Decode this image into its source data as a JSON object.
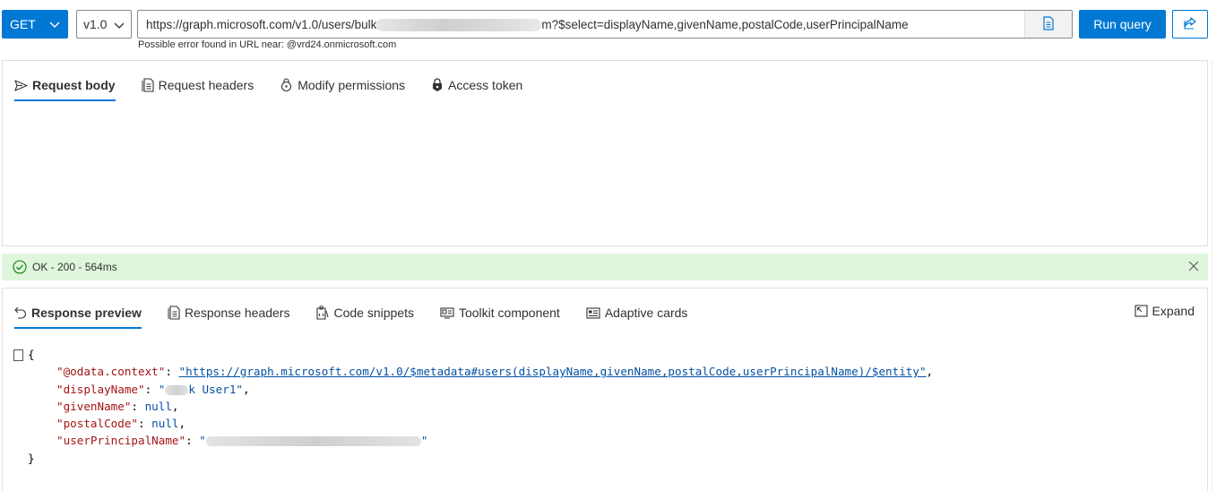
{
  "query": {
    "method": "GET",
    "version": "v1.0",
    "url_prefix": "https://graph.microsoft.com/v1.0/users/bulk",
    "url_suffix": "m?$select=displayName,givenName,postalCode,userPrincipalName",
    "error_hint": "Possible error found in URL near: @vrd24.onmicrosoft.com",
    "run_label": "Run query"
  },
  "request_tabs": [
    {
      "label": "Request body",
      "icon": "send-icon"
    },
    {
      "label": "Request headers",
      "icon": "document-icon"
    },
    {
      "label": "Modify permissions",
      "icon": "permissions-lock-icon"
    },
    {
      "label": "Access token",
      "icon": "shield-lock-icon"
    }
  ],
  "status": {
    "text": "OK - 200 - 564ms",
    "color": "#dff6dd"
  },
  "response_tabs": [
    {
      "label": "Response preview",
      "icon": "undo-arrow-icon"
    },
    {
      "label": "Response headers",
      "icon": "document-icon"
    },
    {
      "label": "Code snippets",
      "icon": "code-snippet-icon"
    },
    {
      "label": "Toolkit component",
      "icon": "toolkit-icon"
    },
    {
      "label": "Adaptive cards",
      "icon": "card-icon"
    }
  ],
  "expand_label": "Expand",
  "json": {
    "open": "{",
    "close": "}",
    "lines": [
      {
        "key": "\"@odata.context\"",
        "value": "\"https://graph.microsoft.com/v1.0/$metadata#users(displayName,givenName,postalCode,userPrincipalName)/$entity\"",
        "type": "link",
        "comma": ","
      },
      {
        "key": "\"displayName\"",
        "value": "\"k User1\"",
        "type": "string",
        "comma": ","
      },
      {
        "key": "\"givenName\"",
        "value": "null",
        "type": "null",
        "comma": ","
      },
      {
        "key": "\"postalCode\"",
        "value": "null",
        "type": "null",
        "comma": ","
      },
      {
        "key": "\"userPrincipalName\"",
        "value": "\"\"",
        "type": "string",
        "comma": ""
      }
    ]
  },
  "colors": {
    "accent": "#0078d4",
    "json_key": "#a31515",
    "json_value": "#0451a5"
  }
}
